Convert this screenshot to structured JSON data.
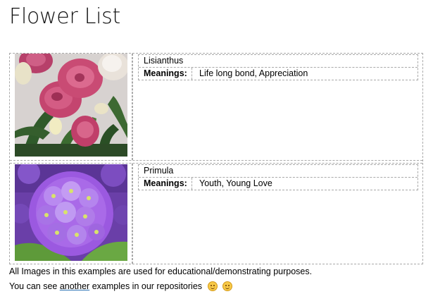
{
  "title": "Flower List",
  "flowers": [
    {
      "name": "Lisianthus",
      "meanings_label": "Meanings:",
      "meanings": "Life long bond, Appreciation",
      "image_icon": "lisianthus-photo"
    },
    {
      "name": "Primula",
      "meanings_label": "Meanings:",
      "meanings": "Youth, Young Love",
      "image_icon": "primula-photo"
    }
  ],
  "footer": {
    "line1": "All Images in this examples are used for educational/demonstrating purposes.",
    "line2_before": "You can see ",
    "line2_link": "another",
    "line2_after": " examples in our repositories",
    "emoji_icon": "smiling-face-emoji"
  },
  "colors": {
    "border": "#a9a9a9",
    "link_underline": "#2e75b6",
    "lisianthus_pink": "#c4456f",
    "primula_purple": "#9b59e0"
  }
}
